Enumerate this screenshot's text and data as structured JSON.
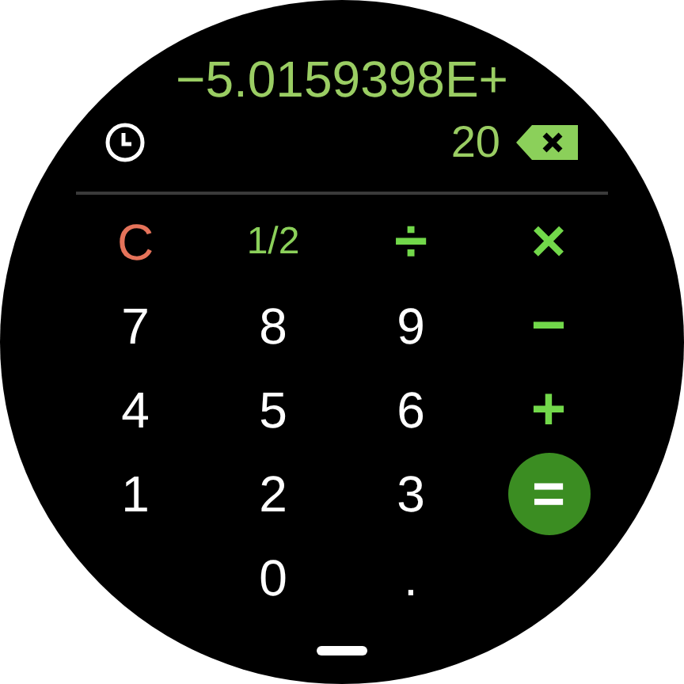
{
  "display": {
    "expression": "−5.0159398E+",
    "result": "20"
  },
  "keys": [
    [
      {
        "label": "C",
        "kind": "clear"
      },
      {
        "label": "1/2",
        "kind": "function"
      },
      {
        "label": "÷",
        "kind": "operator"
      },
      {
        "label": "×",
        "kind": "operator"
      }
    ],
    [
      {
        "label": "7",
        "kind": "digit"
      },
      {
        "label": "8",
        "kind": "digit"
      },
      {
        "label": "9",
        "kind": "digit"
      },
      {
        "label": "−",
        "kind": "operator"
      }
    ],
    [
      {
        "label": "4",
        "kind": "digit"
      },
      {
        "label": "5",
        "kind": "digit"
      },
      {
        "label": "6",
        "kind": "digit"
      },
      {
        "label": "+",
        "kind": "operator"
      }
    ],
    [
      {
        "label": "1",
        "kind": "digit"
      },
      {
        "label": "2",
        "kind": "digit"
      },
      {
        "label": "3",
        "kind": "digit"
      },
      {
        "label": "=",
        "kind": "equals"
      }
    ],
    [
      {
        "label": "0",
        "kind": "digit"
      },
      {
        "label": ".",
        "kind": "digit"
      }
    ]
  ]
}
